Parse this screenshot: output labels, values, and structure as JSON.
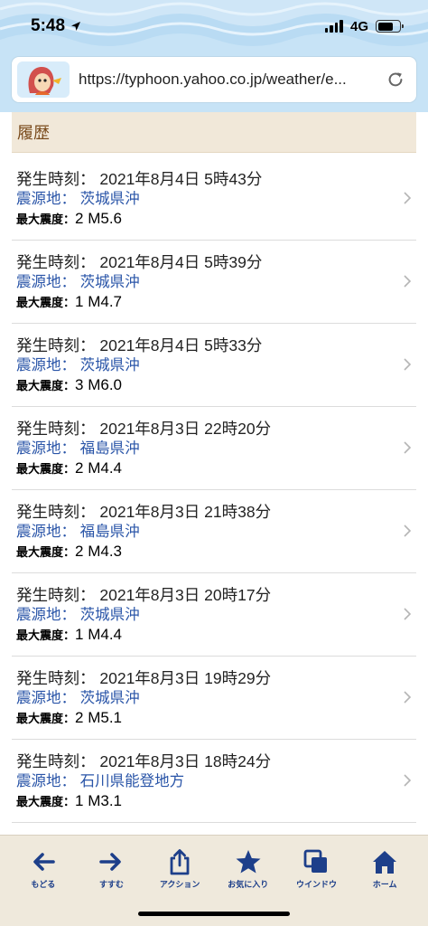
{
  "status": {
    "time": "5:48",
    "network": "4G"
  },
  "browser": {
    "url": "https://typhoon.yahoo.co.jp/weather/e..."
  },
  "section": {
    "title": "履歴"
  },
  "labels": {
    "time": "発生時刻：",
    "epicenter": "震源地：",
    "intensity": "最大震度："
  },
  "quakes": [
    {
      "datetime": "2021年8月4日 5時43分",
      "epicenter": "茨城県沖",
      "intensity": "2",
      "magnitude": "M5.6"
    },
    {
      "datetime": "2021年8月4日 5時39分",
      "epicenter": "茨城県沖",
      "intensity": "1",
      "magnitude": "M4.7"
    },
    {
      "datetime": "2021年8月4日 5時33分",
      "epicenter": "茨城県沖",
      "intensity": "3",
      "magnitude": "M6.0"
    },
    {
      "datetime": "2021年8月3日 22時20分",
      "epicenter": "福島県沖",
      "intensity": "2",
      "magnitude": "M4.4"
    },
    {
      "datetime": "2021年8月3日 21時38分",
      "epicenter": "福島県沖",
      "intensity": "2",
      "magnitude": "M4.3"
    },
    {
      "datetime": "2021年8月3日 20時17分",
      "epicenter": "茨城県沖",
      "intensity": "1",
      "magnitude": "M4.4"
    },
    {
      "datetime": "2021年8月3日 19時29分",
      "epicenter": "茨城県沖",
      "intensity": "2",
      "magnitude": "M5.1"
    },
    {
      "datetime": "2021年8月3日 18時24分",
      "epicenter": "石川県能登地方",
      "intensity": "1",
      "magnitude": "M3.1"
    }
  ],
  "toolbar": [
    {
      "label": "もどる",
      "icon": "back-arrow-icon"
    },
    {
      "label": "すすむ",
      "icon": "forward-arrow-icon"
    },
    {
      "label": "アクション",
      "icon": "share-icon"
    },
    {
      "label": "お気に入り",
      "icon": "star-icon"
    },
    {
      "label": "ウインドウ",
      "icon": "windows-icon"
    },
    {
      "label": "ホーム",
      "icon": "home-icon"
    }
  ],
  "colors": {
    "accent": "#1d3f8a",
    "link": "#2a55a8",
    "section_bg": "#f1e8d9",
    "section_text": "#7a4b1c",
    "header_bg": "#cfe6f7"
  }
}
